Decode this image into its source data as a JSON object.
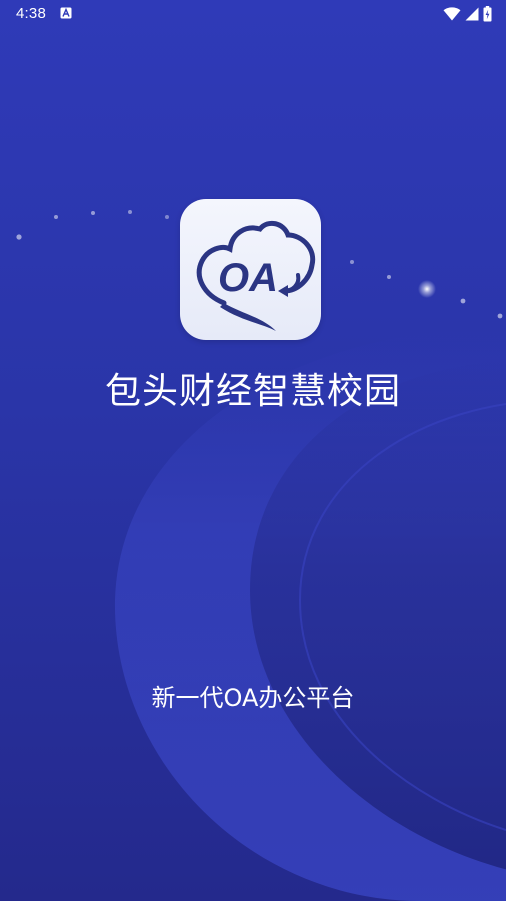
{
  "status_bar": {
    "time": "4:38",
    "icons": [
      "notification-a-icon",
      "wifi-icon",
      "signal-icon",
      "battery-icon"
    ]
  },
  "splash": {
    "app_logo_text": "OA",
    "title": "包头财经智慧校园",
    "subtitle": "新一代OA办公平台"
  },
  "colors": {
    "background_top": "#2f3ab8",
    "background_bottom": "#24298c",
    "logo_navy": "#2b3583",
    "text": "#ffffff"
  }
}
